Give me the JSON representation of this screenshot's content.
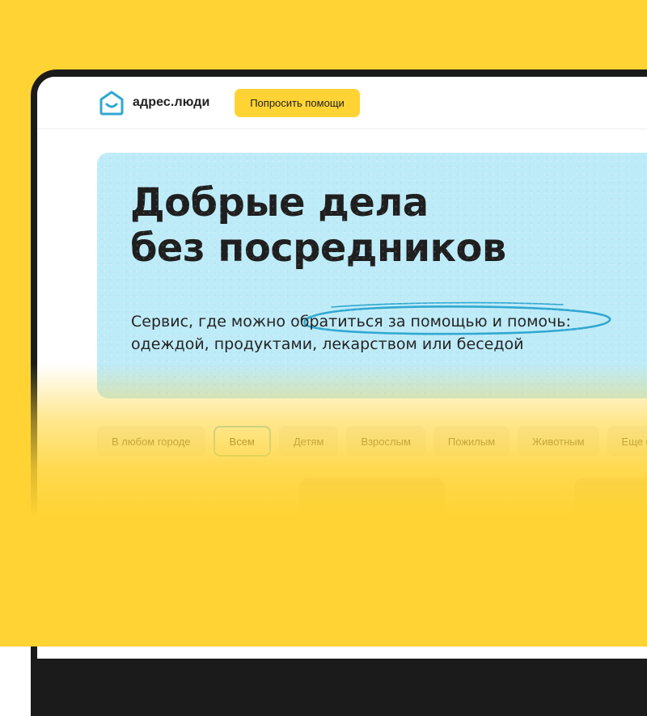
{
  "header": {
    "logo_text": "адрес.люди",
    "help_button": "Попросить помощи"
  },
  "hero": {
    "title_line1": "Добрые дела",
    "title_line2": "без посредников",
    "subtitle_line1": "Сервис, где можно обратиться за помощью и помочь:",
    "subtitle_line2": "одеждой, продуктами, лекарством или беседой"
  },
  "filters": [
    {
      "label": "В любом городе"
    },
    {
      "label": "Всем"
    },
    {
      "label": "Детям"
    },
    {
      "label": "Взрослым"
    },
    {
      "label": "Пожилым"
    },
    {
      "label": "Животным"
    },
    {
      "label": "Еще фи"
    }
  ],
  "colors": {
    "background": "#FFD333",
    "button": "#FFD333",
    "hero": "#BEEBF8",
    "accent": "#2FA8D1"
  },
  "icons": {
    "logo": "house-smile-icon",
    "annotation": "hand-drawn-ellipse",
    "decoration": "doodle-icon"
  }
}
